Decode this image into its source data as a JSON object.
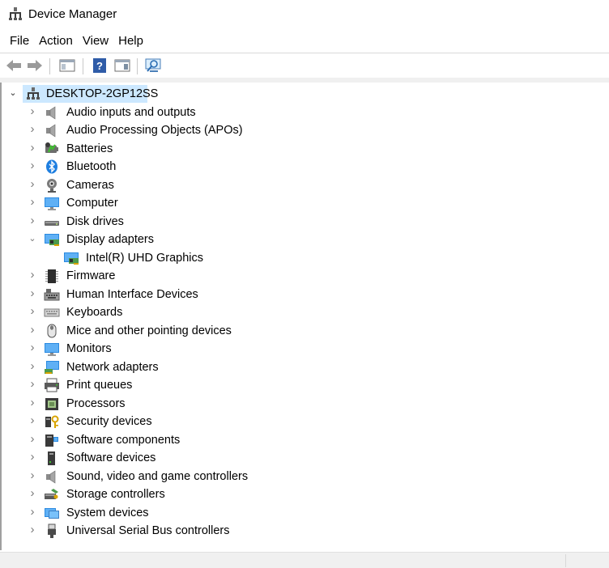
{
  "window": {
    "title": "Device Manager"
  },
  "menu": [
    {
      "label": "File"
    },
    {
      "label": "Action"
    },
    {
      "label": "View"
    },
    {
      "label": "Help"
    }
  ],
  "toolbar": {
    "buttons": [
      {
        "icon": "back-arrow-icon"
      },
      {
        "icon": "forward-arrow-icon"
      },
      {
        "icon": "show-hide-console-tree-icon"
      },
      {
        "icon": "help-icon"
      },
      {
        "icon": "action-pane-icon"
      },
      {
        "icon": "scan-hardware-changes-icon"
      }
    ]
  },
  "tree": {
    "root": {
      "label": "DESKTOP-2GP12SS",
      "expanded": true,
      "selected": true
    },
    "items": [
      {
        "label": "Audio inputs and outputs",
        "icon": "speaker-icon",
        "expanded": false
      },
      {
        "label": "Audio Processing Objects (APOs)",
        "icon": "speaker-icon",
        "expanded": false
      },
      {
        "label": "Batteries",
        "icon": "battery-icon",
        "expanded": false
      },
      {
        "label": "Bluetooth",
        "icon": "bluetooth-icon",
        "expanded": false
      },
      {
        "label": "Cameras",
        "icon": "camera-icon",
        "expanded": false
      },
      {
        "label": "Computer",
        "icon": "computer-icon",
        "expanded": false
      },
      {
        "label": "Disk drives",
        "icon": "disk-drive-icon",
        "expanded": false
      },
      {
        "label": "Display adapters",
        "icon": "display-adapter-icon",
        "expanded": true,
        "children": [
          {
            "label": "Intel(R) UHD Graphics",
            "icon": "display-adapter-icon"
          }
        ]
      },
      {
        "label": "Firmware",
        "icon": "firmware-chip-icon",
        "expanded": false
      },
      {
        "label": "Human Interface Devices",
        "icon": "hid-icon",
        "expanded": false
      },
      {
        "label": "Keyboards",
        "icon": "keyboard-icon",
        "expanded": false
      },
      {
        "label": "Mice and other pointing devices",
        "icon": "mouse-icon",
        "expanded": false
      },
      {
        "label": "Monitors",
        "icon": "monitor-icon",
        "expanded": false
      },
      {
        "label": "Network adapters",
        "icon": "network-adapter-icon",
        "expanded": false
      },
      {
        "label": "Print queues",
        "icon": "printer-icon",
        "expanded": false
      },
      {
        "label": "Processors",
        "icon": "processor-icon",
        "expanded": false
      },
      {
        "label": "Security devices",
        "icon": "security-key-icon",
        "expanded": false
      },
      {
        "label": "Software components",
        "icon": "software-component-icon",
        "expanded": false
      },
      {
        "label": "Software devices",
        "icon": "software-device-icon",
        "expanded": false
      },
      {
        "label": "Sound, video and game controllers",
        "icon": "speaker-icon",
        "expanded": false
      },
      {
        "label": "Storage controllers",
        "icon": "storage-controller-icon",
        "expanded": false
      },
      {
        "label": "System devices",
        "icon": "system-devices-icon",
        "expanded": false
      },
      {
        "label": "Universal Serial Bus controllers",
        "icon": "usb-icon",
        "expanded": false
      }
    ]
  },
  "colors": {
    "selection": "#cce8ff",
    "accent": "#1e88e5"
  }
}
